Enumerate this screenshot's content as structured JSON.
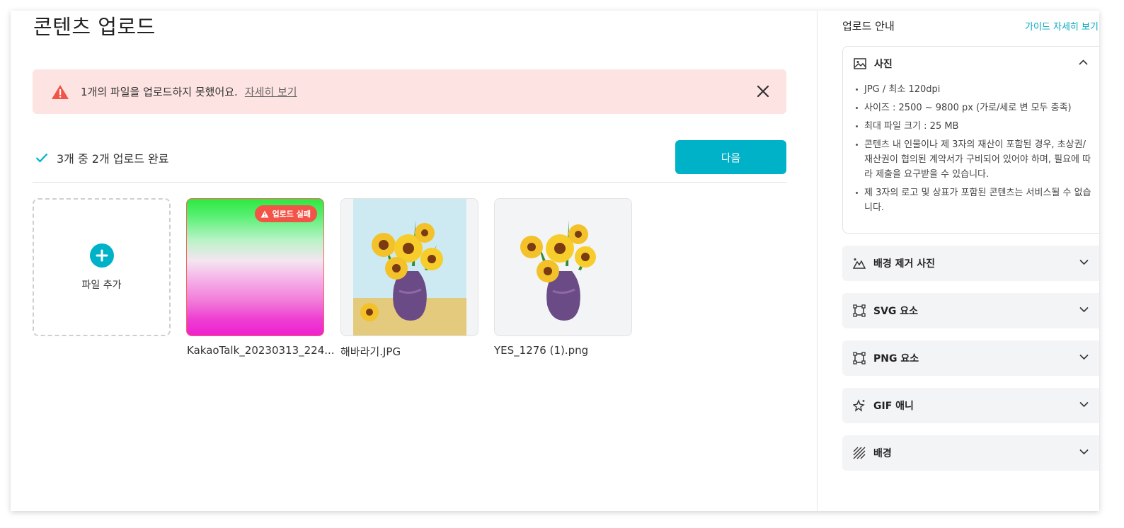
{
  "page": {
    "title": "콘텐츠 업로드"
  },
  "alert": {
    "message": "1개의 파일을 업로드하지 못했어요.",
    "link": "자세히 보기"
  },
  "status": {
    "text": "3개 중 2개 업로드 완료"
  },
  "next_button": {
    "label": "다음"
  },
  "add_tile": {
    "label": "파일 추가"
  },
  "files": [
    {
      "name": "KakaoTalk_20230313_224...",
      "badge": "업로드 실패"
    },
    {
      "name": "해바라기.JPG"
    },
    {
      "name": "YES_1276 (1).png"
    }
  ],
  "side": {
    "heading": "업로드 안내",
    "guide_link": "가이드 자세히 보기",
    "photo": {
      "title": "사진",
      "items": [
        "JPG / 최소 120dpi",
        "사이즈 : 2500 ~ 9800 px (가로/세로 변 모두 충족)",
        "최대 파일 크기 : 25 MB",
        "콘텐츠 내 인물이나 제 3자의 재산이 포함된 경우, 초상권/재산권이 협의된 계약서가 구비되어 있어야 하며, 필요에 따라 제출을 요구받을 수 있습니다.",
        "제 3자의 로고 및 상표가 포함된 콘텐츠는 서비스될 수 없습니다."
      ]
    },
    "sections": [
      {
        "title": "배경 제거 사진",
        "icon": "mountain-cutout-icon"
      },
      {
        "title": "SVG 요소",
        "icon": "vector-frame-icon"
      },
      {
        "title": "PNG 요소",
        "icon": "vector-frame-icon"
      },
      {
        "title": "GIF 애니",
        "icon": "sparkle-star-icon"
      },
      {
        "title": "배경",
        "icon": "diagonal-lines-icon"
      }
    ]
  },
  "colors": {
    "accent": "#00b2c8",
    "alert_bg": "#fde3e1",
    "error": "#f25548"
  }
}
